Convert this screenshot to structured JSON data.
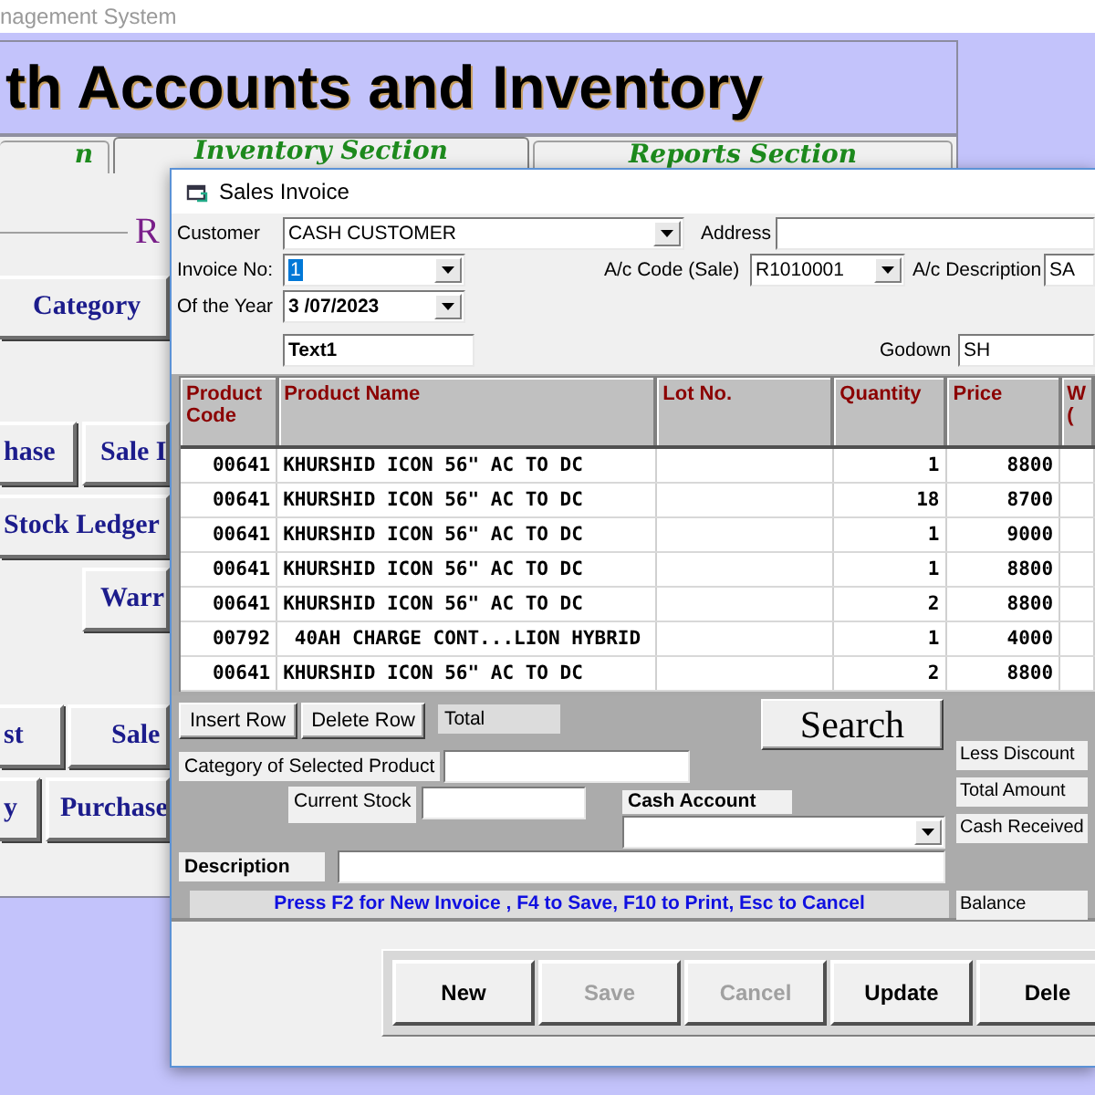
{
  "app": {
    "title": "nagement System",
    "heading": "th Accounts and Inventory",
    "tabs": [
      {
        "label": "n",
        "selected": false
      },
      {
        "label": "Inventory Section",
        "selected": true
      },
      {
        "label": "Reports Section",
        "selected": false
      }
    ],
    "section_letter": "R",
    "button_rows": [
      [
        {
          "label": "Category"
        }
      ],
      [
        {
          "label": "hase"
        },
        {
          "label": "Sale I"
        }
      ],
      [
        {
          "label": "Stock Ledger"
        }
      ],
      [
        {
          "label": "Warr"
        }
      ],
      [
        {
          "label": "st"
        },
        {
          "label": "Sale"
        }
      ],
      [
        {
          "label": "y"
        },
        {
          "label": "Purchase"
        }
      ]
    ]
  },
  "invoice": {
    "title": "Sales Invoice",
    "customer": {
      "label": "Customer",
      "value": "CASH CUSTOMER"
    },
    "address": {
      "label": "Address"
    },
    "invoice_no": {
      "label": "Invoice No:",
      "value": "1",
      "highlighted": true
    },
    "ac_code": {
      "label": "A/c Code (Sale)",
      "value": "R1010001"
    },
    "ac_description": {
      "label": "A/c Description",
      "value": "SA"
    },
    "year": {
      "label": "Of the Year",
      "value": "3 /07/2023"
    },
    "text_field": {
      "value": "Text1"
    },
    "godown": {
      "label": "Godown",
      "value": "SH"
    },
    "table": {
      "columns": [
        "Product Code",
        "Product Name",
        "Lot No.",
        "Quantity",
        "Price",
        "W ("
      ],
      "rows": [
        {
          "code": "00641",
          "name": "KHURSHID ICON 56\" AC TO DC",
          "quantity": "1",
          "price": "8800"
        },
        {
          "code": "00641",
          "name": "KHURSHID ICON 56\" AC TO DC",
          "quantity": "18",
          "price": "8700"
        },
        {
          "code": "00641",
          "name": "KHURSHID ICON 56\" AC TO DC",
          "quantity": "1",
          "price": "9000"
        },
        {
          "code": "00641",
          "name": "KHURSHID ICON 56\" AC TO DC",
          "quantity": "1",
          "price": "8800"
        },
        {
          "code": "00641",
          "name": "KHURSHID ICON 56\" AC TO DC",
          "quantity": "2",
          "price": "8800"
        },
        {
          "code": "00792",
          "name": " 40AH CHARGE CONT...LION HYBRID",
          "quantity": "1",
          "price": "4000"
        },
        {
          "code": "00641",
          "name": "KHURSHID ICON 56\" AC TO DC",
          "quantity": "2",
          "price": "8800"
        }
      ]
    },
    "insert_row": "Insert Row",
    "delete_row": "Delete Row",
    "total_label": "Total",
    "search": "Search",
    "category_label": "Category of Selected Product",
    "current_stock_label": "Current Stock",
    "cash_account_label": "Cash Account",
    "description_label": "Description",
    "hint": "Press F2 for New Invoice , F4 to Save, F10 to Print, Esc to Cancel",
    "summary_labels": [
      "Less Discount",
      "Total Amount",
      "Cash Received",
      "Balance"
    ],
    "actions": [
      {
        "label": "New",
        "disabled": false
      },
      {
        "label": "Save",
        "disabled": true
      },
      {
        "label": "Cancel",
        "disabled": true
      },
      {
        "label": "Update",
        "disabled": false
      },
      {
        "label": "Dele",
        "disabled": false
      }
    ]
  }
}
